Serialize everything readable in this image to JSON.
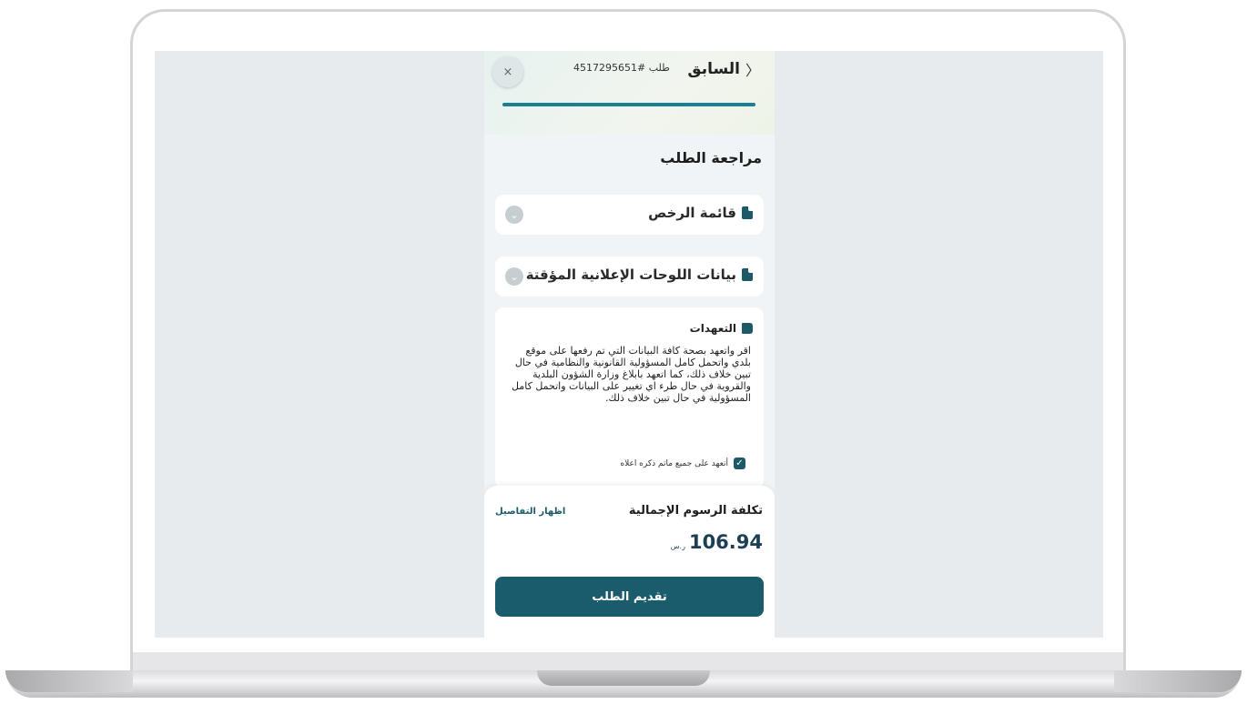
{
  "header": {
    "back_label": "السابق",
    "request_label": "طلب",
    "request_number": "#4517295651",
    "close_symbol": "×",
    "progress_percent": 100
  },
  "review": {
    "title": "مراجعة الطلب",
    "accordions": [
      {
        "label": "قائمة الرخص",
        "icon": "document-icon"
      },
      {
        "label": "بيانات اللوحات الإعلانية المؤقتة",
        "icon": "document-icon"
      }
    ],
    "pledge": {
      "title": "التعهدات",
      "text": "اقر واتعهد بصحة كافة البيانات التي تم رفعها على موقع بلدي واتحمل كامل المسؤولية القانونية والنظامية في حال تبين خلاف ذلك، كما اتعهد بابلاغ وزارة الشؤون البلدية والقروية في حال طرء اي تغيير على البيانات واتحمل كامل المسؤولية في حال تبين خلاف ذلك.",
      "checkbox_label": "أتعهد على جميع ماتم ذكره اعلاه",
      "checked": true
    }
  },
  "footer": {
    "fee_label": "تكلفة الرسوم الإجمالية",
    "details_link": "اظهار التفاصيل",
    "amount": "106.94",
    "currency": "ر.س",
    "submit_label": "تقديم الطلب"
  },
  "colors": {
    "primary": "#1a5b6c",
    "progress": "#1b7f94",
    "background": "#f1f4f7"
  }
}
